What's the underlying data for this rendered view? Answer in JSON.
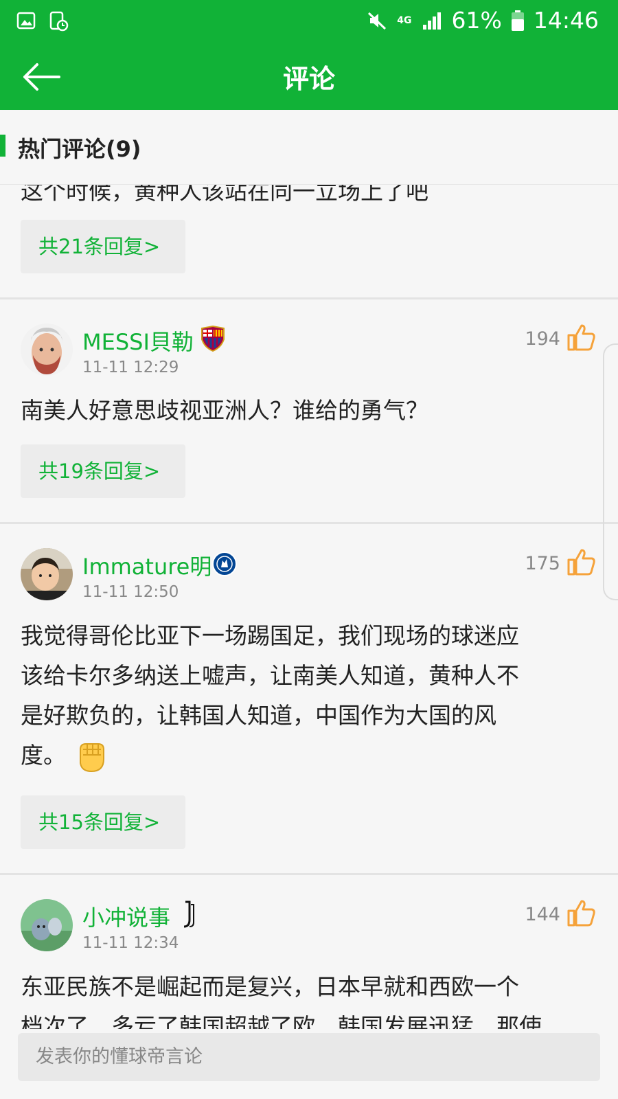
{
  "status_bar": {
    "battery": "61%",
    "time": "14:46",
    "network": "4G"
  },
  "app_bar": {
    "title": "评论"
  },
  "section": {
    "title": "热门评论(9)"
  },
  "partial_comment": {
    "text": "这个时候，黄种人该站在同一立场上了吧",
    "reply_label": "共21条回复>"
  },
  "comments": [
    {
      "user": "MESSI貝勒",
      "team_badge": "barcelona-badge-icon",
      "time": "11-11 12:29",
      "likes": "194",
      "text": "南美人好意思歧视亚洲人？谁给的勇气？",
      "reply_label": "共19条回复>"
    },
    {
      "user": "Immature明",
      "team_badge": "chelsea-badge-icon",
      "time": "11-11 12:50",
      "likes": "175",
      "text_lines": [
        "我觉得哥伦比亚下一场踢国足，我们现场的球迷应",
        "该给卡尔多纳送上嘘声，让南美人知道，黄种人不",
        "是好欺负的，让韩国人知道，中国作为大国的风",
        "度。"
      ],
      "reply_label": "共15条回复>"
    },
    {
      "user": "小冲说事",
      "team_badge": "juventus-badge-icon",
      "time": "11-11 12:34",
      "likes": "144",
      "text_lines": [
        "东亚民族不是崛起而是复兴，日本早就和西欧一个",
        "档次了，多亏了韩国超越了欧，韩国发展迅猛，那使"
      ]
    }
  ],
  "input": {
    "placeholder": "发表你的懂球帝言论"
  },
  "colors": {
    "brand_green": "#11b237",
    "like_orange": "#f5a23a"
  }
}
